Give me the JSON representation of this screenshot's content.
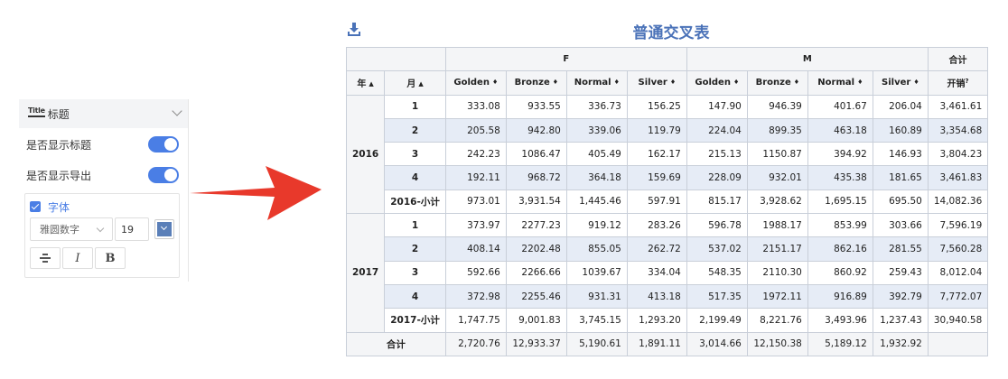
{
  "panel": {
    "title_icon_text": "Title",
    "title": "标题",
    "show_title_label": "是否显示标题",
    "show_export_label": "是否显示导出",
    "font_label": "字体",
    "font_family_value": "雅圆数字",
    "font_size_value": "19",
    "font_color": "#5a7fb8"
  },
  "report": {
    "title": "普通交叉表",
    "download_icon": "download-icon",
    "group_header_f": "F",
    "group_header_m": "M",
    "group_header_total": "合计",
    "year_header": "年",
    "month_header": "月",
    "metric_header": "开销",
    "col_headers": [
      "Golden",
      "Bronze",
      "Normal",
      "Silver",
      "Golden",
      "Bronze",
      "Normal",
      "Silver"
    ],
    "rows": [
      {
        "year": "2016",
        "month": "1",
        "vals": [
          "333.08",
          "933.55",
          "336.73",
          "156.25",
          "147.90",
          "946.39",
          "401.67",
          "206.04",
          "3,461.61"
        ]
      },
      {
        "year": "",
        "month": "2",
        "vals": [
          "205.58",
          "942.80",
          "339.06",
          "119.79",
          "224.04",
          "899.35",
          "463.18",
          "160.89",
          "3,354.68"
        ]
      },
      {
        "year": "",
        "month": "3",
        "vals": [
          "242.23",
          "1086.47",
          "405.49",
          "162.17",
          "215.13",
          "1150.87",
          "394.92",
          "146.93",
          "3,804.23"
        ]
      },
      {
        "year": "",
        "month": "4",
        "vals": [
          "192.11",
          "968.72",
          "364.18",
          "159.69",
          "228.09",
          "932.01",
          "435.38",
          "181.65",
          "3,461.83"
        ]
      },
      {
        "year": "",
        "month": "2016-小计",
        "vals": [
          "973.01",
          "3,931.54",
          "1,445.46",
          "597.91",
          "815.17",
          "3,928.62",
          "1,695.15",
          "695.50",
          "14,082.36"
        ]
      },
      {
        "year": "2017",
        "month": "1",
        "vals": [
          "373.97",
          "2277.23",
          "919.12",
          "283.26",
          "596.78",
          "1988.17",
          "853.99",
          "303.66",
          "7,596.19"
        ]
      },
      {
        "year": "",
        "month": "2",
        "vals": [
          "408.14",
          "2202.48",
          "855.05",
          "262.72",
          "537.02",
          "2151.17",
          "862.16",
          "281.55",
          "7,560.28"
        ]
      },
      {
        "year": "",
        "month": "3",
        "vals": [
          "592.66",
          "2266.66",
          "1039.67",
          "334.04",
          "548.35",
          "2110.30",
          "860.92",
          "259.43",
          "8,012.04"
        ]
      },
      {
        "year": "",
        "month": "4",
        "vals": [
          "372.98",
          "2255.46",
          "931.31",
          "413.18",
          "517.35",
          "1972.11",
          "916.89",
          "392.79",
          "7,772.07"
        ]
      },
      {
        "year": "",
        "month": "2017-小计",
        "vals": [
          "1,747.75",
          "9,001.83",
          "3,745.15",
          "1,293.20",
          "2,199.49",
          "8,221.76",
          "3,493.96",
          "1,237.43",
          "30,940.58"
        ]
      }
    ],
    "total_label": "合计",
    "total_vals": [
      "2,720.76",
      "12,933.37",
      "5,190.61",
      "1,891.11",
      "3,014.66",
      "12,150.38",
      "5,189.12",
      "1,932.92",
      ""
    ]
  }
}
